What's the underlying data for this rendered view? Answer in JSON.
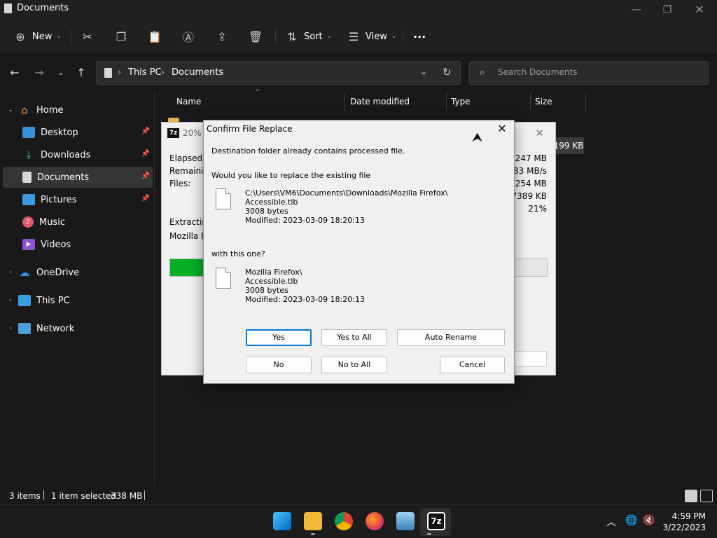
{
  "explorer": {
    "window_title": "Documents",
    "toolbar": {
      "new_label": "New",
      "sort_label": "Sort",
      "view_label": "View",
      "more_label": "···"
    },
    "breadcrumb": [
      "This PC",
      "Documents"
    ],
    "search": {
      "placeholder": "Search Documents"
    },
    "sidebar": {
      "items": [
        {
          "label": "Home",
          "icon": "home-icon",
          "expandable": true,
          "expanded": true
        },
        {
          "label": "Desktop",
          "icon": "desktop-icon",
          "pinned": true
        },
        {
          "label": "Downloads",
          "icon": "download-icon",
          "pinned": true
        },
        {
          "label": "Documents",
          "icon": "document-icon",
          "pinned": true,
          "selected": true
        },
        {
          "label": "Pictures",
          "icon": "pictures-icon",
          "pinned": true
        },
        {
          "label": "Music",
          "icon": "music-icon"
        },
        {
          "label": "Videos",
          "icon": "videos-icon"
        },
        {
          "label": "OneDrive",
          "icon": "cloud-icon",
          "expandable": true
        },
        {
          "label": "This PC",
          "icon": "computer-icon",
          "expandable": true
        },
        {
          "label": "Network",
          "icon": "network-icon",
          "expandable": true
        }
      ]
    },
    "columns": {
      "name": "Name",
      "date": "Date modified",
      "type": "Type",
      "size": "Size"
    },
    "visible_size": "199 KB",
    "status": {
      "items_count": "3 items",
      "selection": "1 item selected",
      "selection_size": "338 MB"
    }
  },
  "progress_window": {
    "logo": "7z",
    "title": "20% E",
    "labels": {
      "elapsed": "Elapsed ti",
      "remaining": "Remaining",
      "files": "Files:",
      "extracting": "Extracting",
      "current": "Mozilla Firef"
    },
    "values": {
      "total": "1247 MB",
      "speed": "83 MB/s",
      "processed": "254 MB",
      "compressed": "57389 KB",
      "percent": "21%"
    },
    "progress_fraction": 0.21,
    "button_fragment": "l"
  },
  "dialog": {
    "title": "Confirm File Replace",
    "message": "Destination folder already contains processed file.",
    "question": "Would you like to replace the existing file",
    "existing": {
      "path": "C:\\Users\\VM6\\Documents\\Downloads\\Mozilla Firefox\\",
      "name": "Accessible.tlb",
      "size": "3008 bytes",
      "modified": "Modified: 2023-03-09 18:20:13"
    },
    "with_label": "with this one?",
    "incoming": {
      "path": "Mozilla Firefox\\",
      "name": "Accessible.tlb",
      "size": "3008 bytes",
      "modified": "Modified: 2023-03-09 18:20:13"
    },
    "buttons": {
      "yes": "Yes",
      "yes_all": "Yes to All",
      "auto_rename": "Auto Rename",
      "no": "No",
      "no_all": "No to All",
      "cancel": "Cancel"
    }
  },
  "taskbar": {
    "time": "4:59 PM",
    "date": "3/22/2023"
  }
}
